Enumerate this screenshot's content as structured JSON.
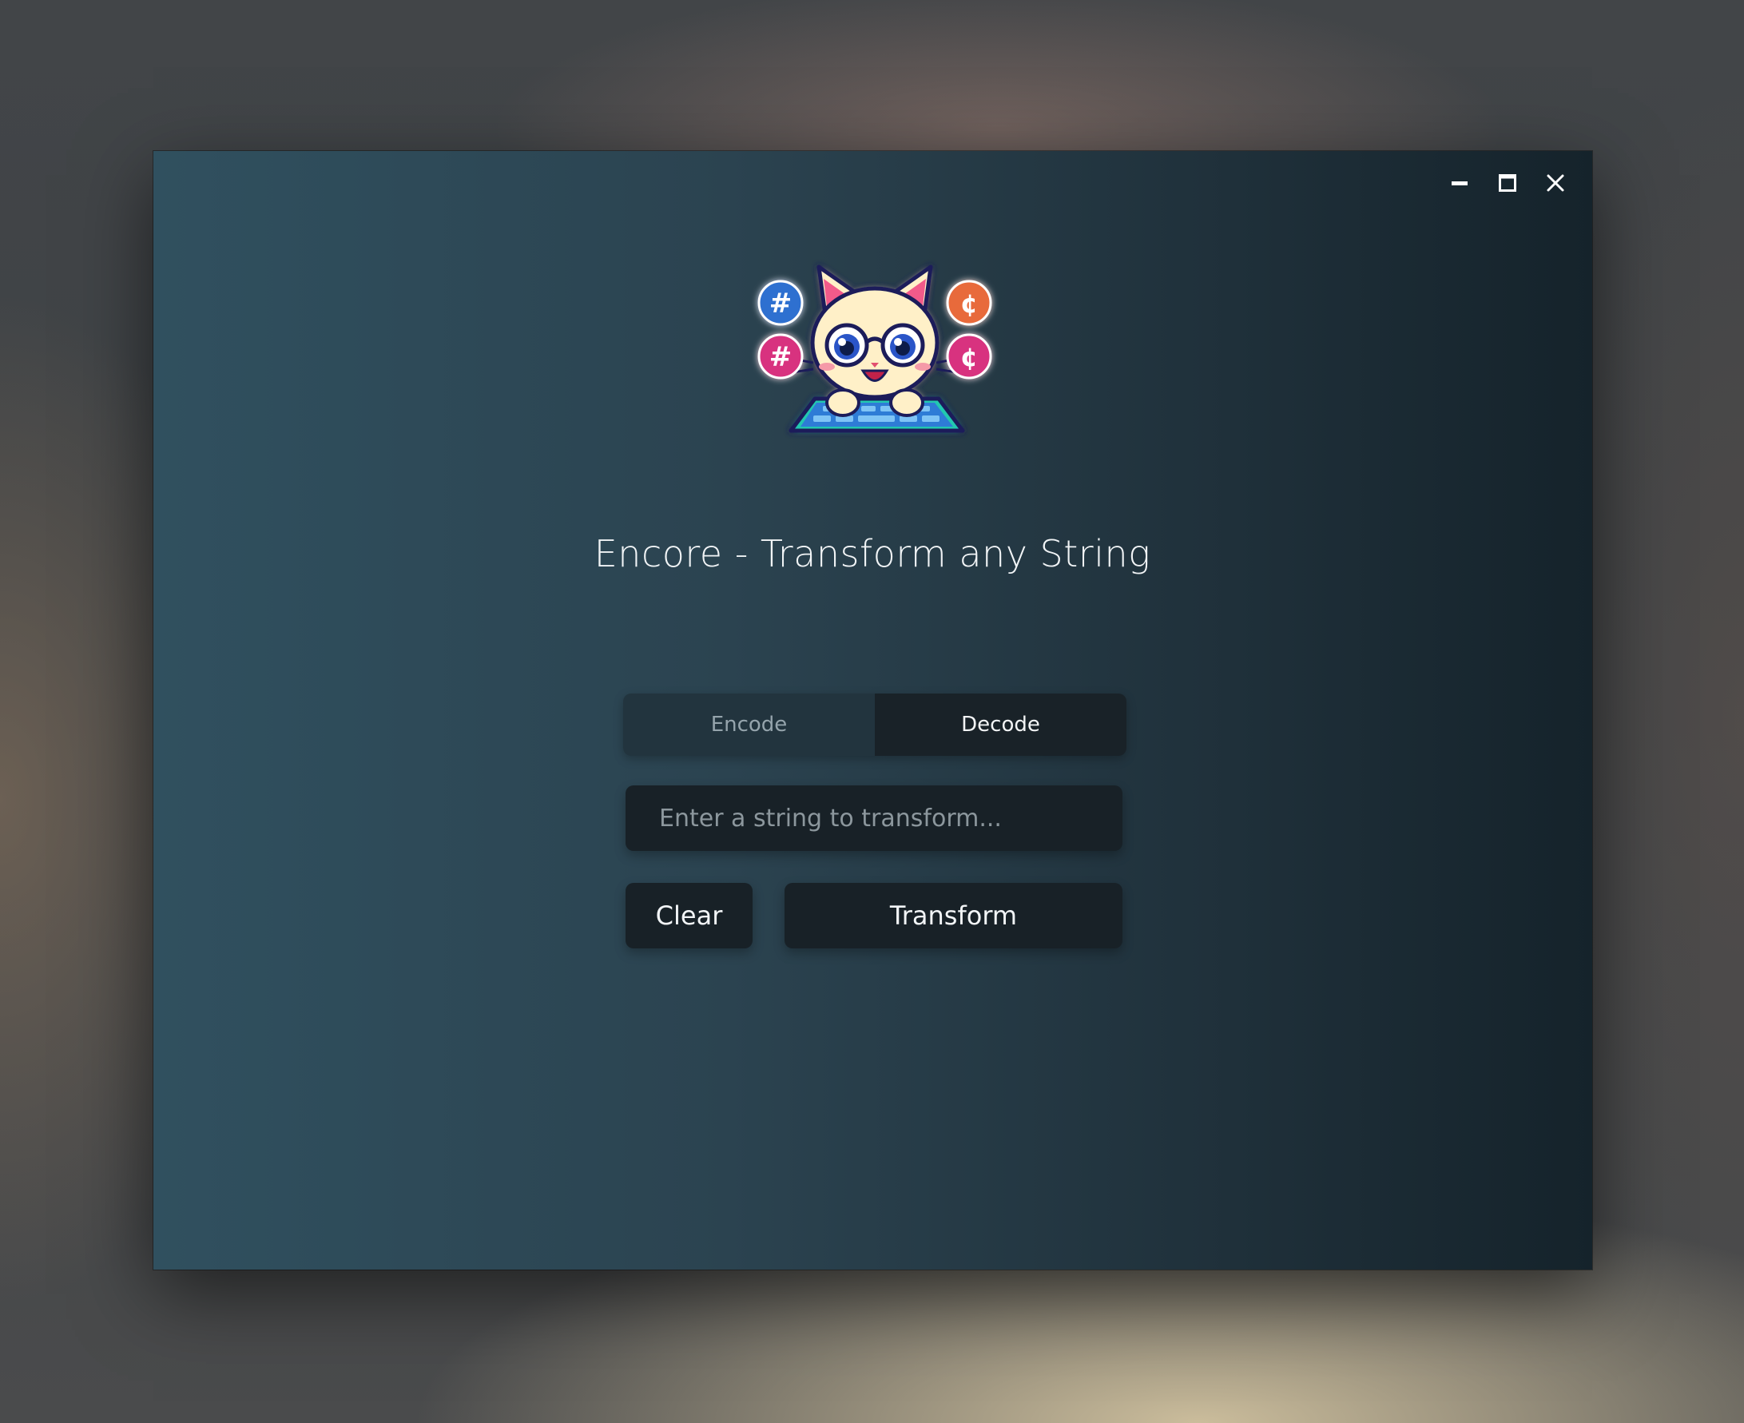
{
  "window": {
    "controls": {
      "minimize_icon": "minimize-icon",
      "maximize_icon": "maximize-icon",
      "close_icon": "close-icon"
    }
  },
  "app": {
    "logo": "cat-keyboard-logo",
    "title": "Encore - Transform any String"
  },
  "mode": {
    "options": [
      {
        "label": "Encode",
        "selected": false
      },
      {
        "label": "Decode",
        "selected": true
      }
    ]
  },
  "input": {
    "value": "",
    "placeholder": "Enter a string to transform..."
  },
  "actions": {
    "clear_label": "Clear",
    "transform_label": "Transform"
  },
  "colors": {
    "window_gradient_start": "#30505f",
    "window_gradient_end": "#15232b",
    "control_bg": "#182127",
    "text": "#f2f5f7"
  }
}
